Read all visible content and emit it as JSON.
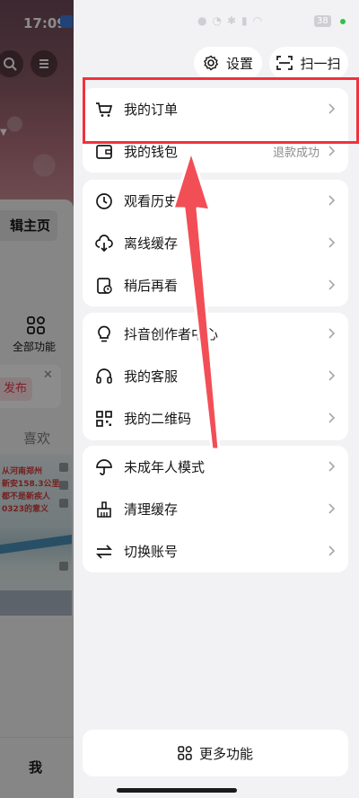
{
  "status_bar": {
    "time": "17:09",
    "battery": "38"
  },
  "background_page": {
    "edit_profile_label": "辑主页",
    "all_functions_label": "全部功能",
    "publish_label": "发布",
    "likes_tab_label": "喜欢",
    "me_tab_label": "我",
    "thumb_text_1": "从河南郑州",
    "thumb_text_2": "新安158.3公里",
    "thumb_text_3": "都不是新疾人",
    "thumb_text_4": "0323的意义"
  },
  "drawer": {
    "settings_label": "设置",
    "scan_label": "扫一扫",
    "sections": [
      {
        "items": [
          {
            "label": "我的订单",
            "icon": "cart-icon",
            "right": ""
          },
          {
            "label": "我的钱包",
            "icon": "wallet-icon",
            "right": "退款成功"
          }
        ]
      },
      {
        "items": [
          {
            "label": "观看历史",
            "icon": "clock-icon",
            "right": ""
          },
          {
            "label": "离线缓存",
            "icon": "cloud-download-icon",
            "right": ""
          },
          {
            "label": "稍后再看",
            "icon": "watch-later-icon",
            "right": ""
          }
        ]
      },
      {
        "items": [
          {
            "label": "抖音创作者中心",
            "icon": "lightbulb-icon",
            "right": ""
          },
          {
            "label": "我的客服",
            "icon": "headset-icon",
            "right": ""
          },
          {
            "label": "我的二维码",
            "icon": "qr-code-icon",
            "right": ""
          }
        ]
      },
      {
        "items": [
          {
            "label": "未成年人模式",
            "icon": "umbrella-icon",
            "right": ""
          },
          {
            "label": "清理缓存",
            "icon": "broom-icon",
            "right": ""
          },
          {
            "label": "切换账号",
            "icon": "switch-account-icon",
            "right": ""
          }
        ]
      }
    ],
    "more_functions_label": "更多功能"
  },
  "annotation": {
    "highlight_color": "#f0323c",
    "arrow_color": "#f24e56"
  }
}
